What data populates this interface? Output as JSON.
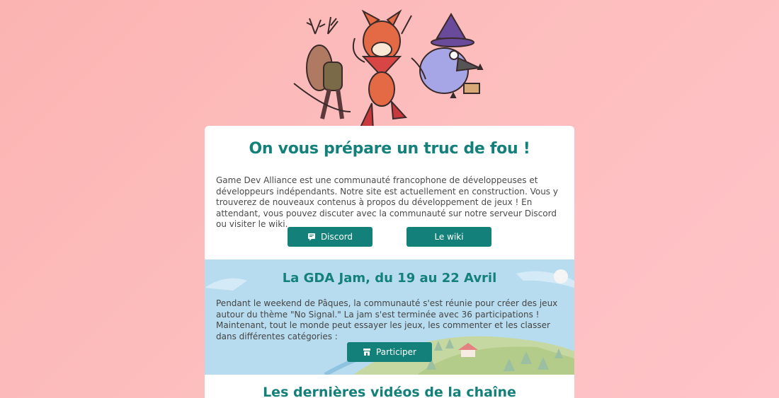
{
  "hero": {
    "image": "three-mascots-illustration"
  },
  "intro": {
    "title": "On vous prépare un truc de fou !",
    "description": "Game Dev Alliance est une communauté francophone de développeuses et développeurs indépendants. Notre site est actuellement en construction. Vous y trouverez de nouveaux contenus à propos du développement de jeux ! En attendant, vous pouvez discuter avec la communauté sur notre serveur Discord ou visiter le wiki.",
    "discord_label": "Discord",
    "wiki_label": "Le wiki"
  },
  "jam": {
    "title": "La GDA Jam, du 19 au 22 Avril",
    "description": "Pendant le weekend de Pâques, la communauté s'est réunie pour créer des jeux autour du thème \"No Signal.\" La jam s'est terminée avec 36 participations ! Maintenant, tout le monde peut essayer les jeux, les commenter et les classer dans différentes catégories :",
    "participate_label": "Participer"
  },
  "videos": {
    "title": "Les dernières vidéos de la chaîne"
  },
  "colors": {
    "accent": "#14807a",
    "background": "#fdbdbd",
    "jam_bg": "#b8dcef"
  }
}
